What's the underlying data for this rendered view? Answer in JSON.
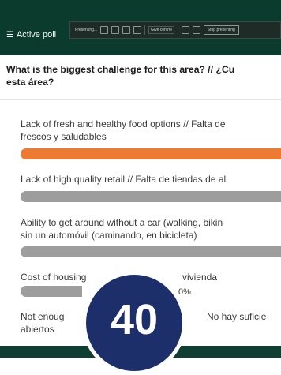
{
  "header": {
    "title": "Active poll",
    "toolbar": {
      "presenting_label": "Presenting...",
      "control_label": "Give control",
      "stop_label": "Stop presenting"
    }
  },
  "poll": {
    "question_line1": "What is the biggest challenge for this area? // ¿Cu",
    "question_line2": "esta área?",
    "options": [
      {
        "line1": "Lack of fresh and healthy food options // Falta de",
        "line2": "frescos y saludables",
        "fill": 1.0
      },
      {
        "line1": "Lack of high quality retail // Falta de tiendas de al",
        "fill": 1.0
      },
      {
        "line1": "Ability to get around without a car (walking, bikin",
        "line2": "sin un automóvil (caminando, en bicicleta)",
        "fill": 1.0
      },
      {
        "line1_left": "Cost of housing",
        "line1_right": "vivienda",
        "percent": "0%"
      },
      {
        "line1_left": "Not enoug",
        "line1_right": "No hay suficie",
        "line2": "abiertos"
      }
    ]
  },
  "overlay": {
    "counter": "40"
  },
  "colors": {
    "accent_bar": "#ec7a33",
    "neutral_bar": "#9d9d9d",
    "header_bg": "#0b3b2c",
    "counter_bg": "#1c2f6a"
  }
}
